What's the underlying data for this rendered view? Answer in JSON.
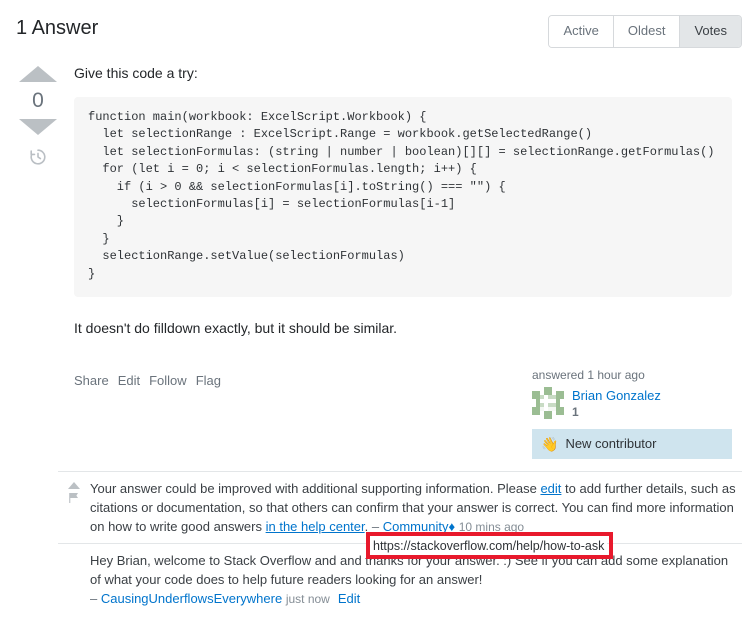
{
  "header": {
    "answers_title": "1 Answer",
    "tabs": [
      {
        "label": "Active",
        "selected": false
      },
      {
        "label": "Oldest",
        "selected": false
      },
      {
        "label": "Votes",
        "selected": true
      }
    ]
  },
  "answer": {
    "vote_count": "0",
    "intro_text": "Give this code a try:",
    "code": "function main(workbook: ExcelScript.Workbook) {\n  let selectionRange : ExcelScript.Range = workbook.getSelectedRange()\n  let selectionFormulas: (string | number | boolean)[][] = selectionRange.getFormulas()\n  for (let i = 0; i < selectionFormulas.length; i++) {\n    if (i > 0 && selectionFormulas[i].toString() === \"\") {\n      selectionFormulas[i] = selectionFormulas[i-1]\n    }\n  }\n  selectionRange.setValue(selectionFormulas)\n}",
    "outro_text": "It doesn't do filldown exactly, but it should be similar.",
    "actions": [
      "Share",
      "Edit",
      "Follow",
      "Flag"
    ],
    "usercard": {
      "answered_label": "answered 1 hour ago",
      "username": "Brian Gonzalez",
      "reputation": "1",
      "badge_label": "New contributor",
      "badge_icon": "waving-hand-icon",
      "badge_color": "#cfe4ee",
      "avatar_color": "#9bbd93"
    }
  },
  "comments": [
    {
      "text_part1": "Your answer could be improved with additional supporting information. Please ",
      "link1": "edit",
      "text_part2": " to add further details, such as citations or documentation, so that others can confirm that your answer is correct. You can find more information on how to write good answers ",
      "link2": "in the help center",
      "text_part3": ". ",
      "dash": "– ",
      "author": "Community",
      "diamond": "♦",
      "time": "10 mins ago"
    },
    {
      "text_part1": "Hey Brian, welcome to Stack Overflow and and thanks for your answer. :) See if you can add some explanation of what your code does to help future readers looking for an answer!",
      "dash": "– ",
      "author": "CausingUnderflowsEverywhere",
      "time": "just now",
      "edit_label": "Edit"
    }
  ],
  "status_bar": {
    "url": "https://stackoverflow.com/help/how-to-ask"
  },
  "annotation": {
    "color": "#e8192c"
  },
  "icons": {
    "vote_up": "upvote-arrow-icon",
    "vote_down": "downvote-arrow-icon",
    "history": "history-clock-icon",
    "flag": "flag-icon"
  }
}
